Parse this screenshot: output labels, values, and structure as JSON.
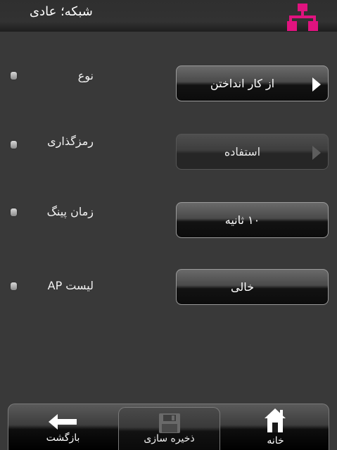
{
  "header": {
    "title": "شبکه؛ عادی",
    "icon": "network-icon",
    "accent_color": "#e0137f"
  },
  "rows": [
    {
      "label": "نوع",
      "value": "از کار انداختن",
      "enabled": true
    },
    {
      "label": "رمزگذاری",
      "value": "استفاده",
      "enabled": false
    },
    {
      "label": "زمان پینگ",
      "value": "۱۰ ثانیه",
      "enabled": true
    },
    {
      "label": "لیست AP",
      "value": "خالی",
      "enabled": true
    }
  ],
  "bottom_bar": {
    "back_label": "بازگشت",
    "save_label": "ذخیره سازی",
    "home_label": "خانه"
  }
}
